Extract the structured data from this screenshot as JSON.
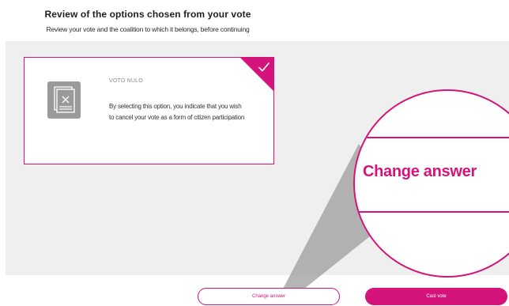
{
  "header": {
    "title": "Review of the options chosen from your vote",
    "subtitle": "Review your vote and the coalition to which it belongs, before continuing"
  },
  "selected_option": {
    "label": "VOTO NULO",
    "description": "By selecting this option, you indicate that you wish to cancel your vote as a form of citizen participation",
    "selected": true,
    "icon": "null-ballot-icon",
    "check_icon": "checkmark-icon"
  },
  "zoom_callout": {
    "text": "Change answer"
  },
  "actions": {
    "change_label": "Change answer",
    "cast_label": "Cast vote"
  },
  "colors": {
    "accent": "#d4147a",
    "panel": "#efefef",
    "icon_gray": "#9a9a9a"
  }
}
